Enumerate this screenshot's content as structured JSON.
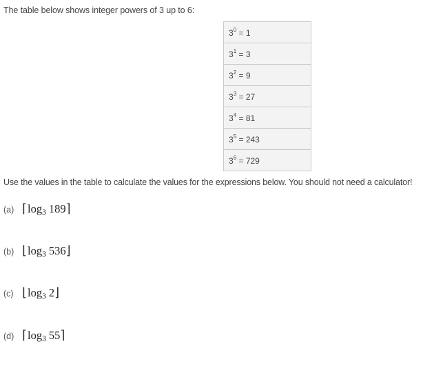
{
  "intro_text": "The table below shows integer powers of 3 up to 6:",
  "powers_table": {
    "rows": [
      {
        "base": "3",
        "exponent": "0",
        "value": "1"
      },
      {
        "base": "3",
        "exponent": "1",
        "value": "3"
      },
      {
        "base": "3",
        "exponent": "2",
        "value": "9"
      },
      {
        "base": "3",
        "exponent": "3",
        "value": "27"
      },
      {
        "base": "3",
        "exponent": "4",
        "value": "81"
      },
      {
        "base": "3",
        "exponent": "5",
        "value": "243"
      },
      {
        "base": "3",
        "exponent": "6",
        "value": "729"
      }
    ]
  },
  "instruction_text": "Use the values in the table to calculate the values for the expressions below. You should not need a calculator!",
  "questions": [
    {
      "label": "(a)",
      "open": "⌈",
      "func": "log",
      "base": "3",
      "arg": "189",
      "close": "⌉",
      "type": "ceiling"
    },
    {
      "label": "(b)",
      "open": "⌊",
      "func": "log",
      "base": "3",
      "arg": "536",
      "close": "⌋",
      "type": "floor"
    },
    {
      "label": "(c)",
      "open": "⌊",
      "func": "log",
      "base": "3",
      "arg": "2",
      "close": "⌋",
      "type": "floor"
    },
    {
      "label": "(d)",
      "open": "⌈",
      "func": "log",
      "base": "3",
      "arg": "55",
      "close": "⌉",
      "type": "ceiling"
    }
  ]
}
